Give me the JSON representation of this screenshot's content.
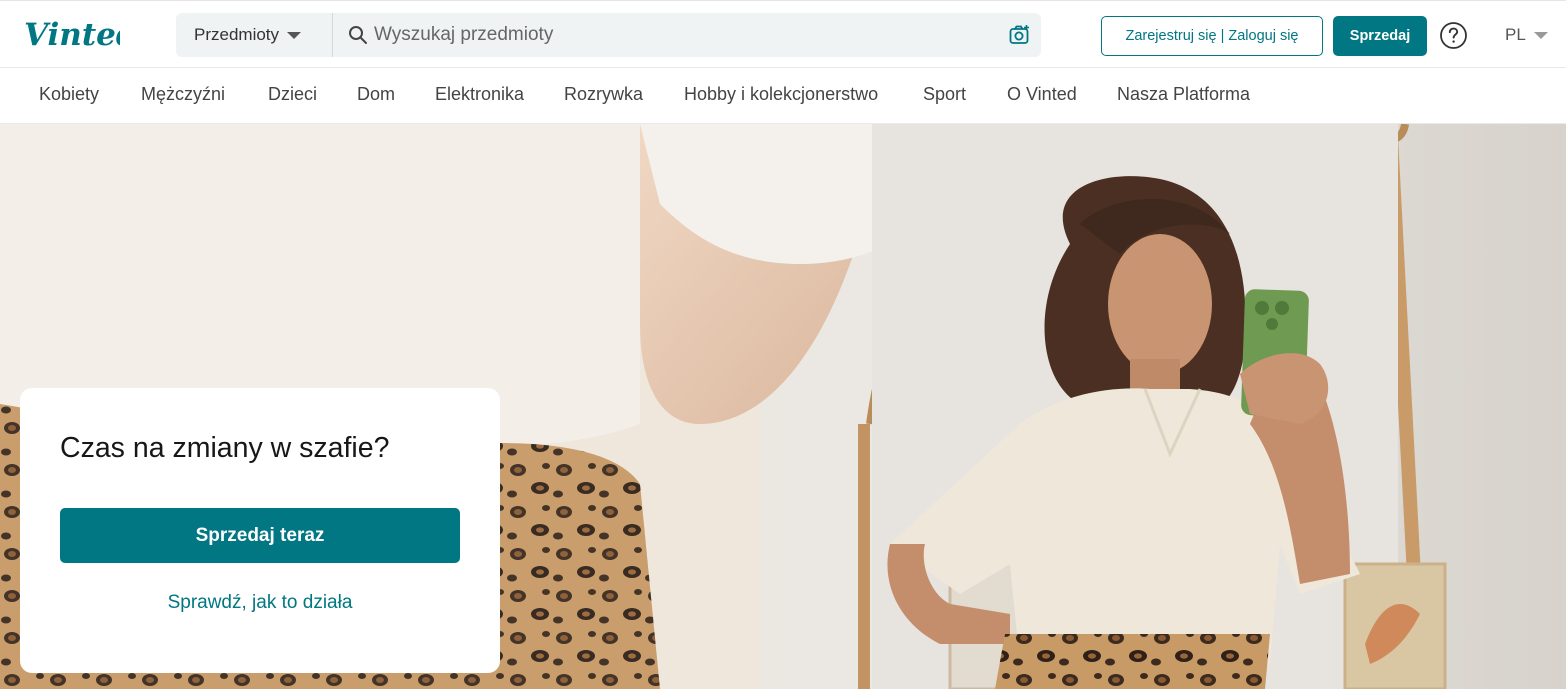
{
  "brand": {
    "logo_text": "Vinted",
    "accent_color": "#007782"
  },
  "header": {
    "category_select": "Przedmioty",
    "search": {
      "placeholder": "Wyszukaj przedmioty",
      "value": ""
    },
    "auth_button": "Zarejestruj się | Zaloguj się",
    "sell_button": "Sprzedaj",
    "help_icon": "question-circle-icon",
    "language": "PL"
  },
  "nav": {
    "items": [
      "Kobiety",
      "Mężczyźni",
      "Dzieci",
      "Dom",
      "Elektronika",
      "Rozrywka",
      "Hobby i kolekcjonerstwo",
      "Sport",
      "O Vinted",
      "Nasza Platforma"
    ]
  },
  "hero": {
    "title": "Czas na zmiany w szafie?",
    "primary_button": "Sprzedaj teraz",
    "secondary_link": "Sprawdź, jak to działa"
  }
}
